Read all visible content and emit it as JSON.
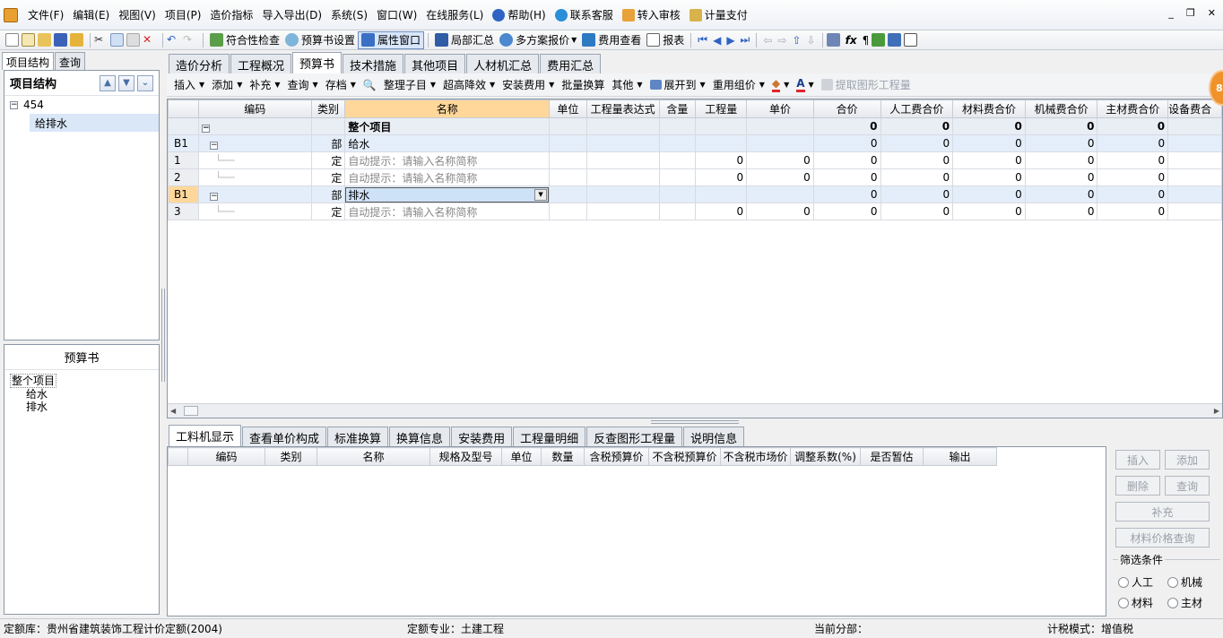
{
  "menubar": {
    "items": [
      "文件(F)",
      "编辑(E)",
      "视图(V)",
      "项目(P)",
      "造价指标",
      "导入导出(D)",
      "系统(S)",
      "窗口(W)",
      "在线服务(L)",
      "帮助(H)",
      "联系客服",
      "转入审核",
      "计量支付"
    ]
  },
  "toolbar": {
    "items": [
      "符合性检查",
      "预算书设置",
      "属性窗口",
      "局部汇总",
      "多方案报价",
      "费用查看",
      "报表"
    ]
  },
  "left": {
    "tabs": [
      "项目结构",
      "查询"
    ],
    "tree_title": "项目结构",
    "tree": [
      "454",
      "给排水"
    ],
    "budget_title": "预算书",
    "budget_tree": [
      "整个项目",
      "给水",
      "排水"
    ]
  },
  "main": {
    "tabs": [
      "造价分析",
      "工程概况",
      "预算书",
      "技术措施",
      "其他项目",
      "人材机汇总",
      "费用汇总"
    ],
    "subtoolbar": [
      "插入",
      "添加",
      "补充",
      "查询",
      "存档",
      "整理子目",
      "超高降效",
      "安装费用",
      "批量换算",
      "其他",
      "展开到",
      "重用组价",
      "提取图形工程量"
    ],
    "columns": [
      "编码",
      "类别",
      "名称",
      "单位",
      "工程量表达式",
      "含量",
      "工程量",
      "单价",
      "合价",
      "人工费合价",
      "材料费合价",
      "机械费合价",
      "主材费合价",
      "设备费合"
    ],
    "rows": [
      {
        "rh": "",
        "code": "",
        "type": "",
        "name": "整个项目",
        "qty": "",
        "price": "",
        "total": "0",
        "rg": "0",
        "cl": "0",
        "jx": "0",
        "zc": "0"
      },
      {
        "rh": "B1",
        "code": "",
        "type": "部",
        "name": "给水",
        "qty": "",
        "price": "",
        "total": "0",
        "rg": "0",
        "cl": "0",
        "jx": "0",
        "zc": "0"
      },
      {
        "rh": "1",
        "code": "",
        "type": "定",
        "name": "自动提示：请输入名称简称",
        "qty": "0",
        "price": "0",
        "total": "0",
        "rg": "0",
        "cl": "0",
        "jx": "0",
        "zc": "0"
      },
      {
        "rh": "2",
        "code": "",
        "type": "定",
        "name": "自动提示：请输入名称简称",
        "qty": "0",
        "price": "0",
        "total": "0",
        "rg": "0",
        "cl": "0",
        "jx": "0",
        "zc": "0"
      },
      {
        "rh": "B1",
        "code": "",
        "type": "部",
        "name": "排水",
        "qty": "",
        "price": "",
        "total": "0",
        "rg": "0",
        "cl": "0",
        "jx": "0",
        "zc": "0"
      },
      {
        "rh": "3",
        "code": "",
        "type": "定",
        "name": "自动提示：请输入名称简称",
        "qty": "0",
        "price": "0",
        "total": "0",
        "rg": "0",
        "cl": "0",
        "jx": "0",
        "zc": "0"
      }
    ]
  },
  "bottom": {
    "tabs": [
      "工料机显示",
      "查看单价构成",
      "标准换算",
      "换算信息",
      "安装费用",
      "工程量明细",
      "反查图形工程量",
      "说明信息"
    ],
    "columns": [
      "编码",
      "类别",
      "名称",
      "规格及型号",
      "单位",
      "数量",
      "含税预算价",
      "不含税预算价",
      "不含税市场价",
      "调整系数(%)",
      "是否暂估",
      "输出"
    ],
    "buttons": [
      "插入",
      "添加",
      "删除",
      "查询",
      "补充",
      "材料价格查询"
    ],
    "filter_title": "筛选条件",
    "filters": [
      "人工",
      "机械",
      "材料",
      "主材"
    ]
  },
  "status": {
    "quota_lib": "定额库：贵州省建筑装饰工程计价定额(2004)",
    "quota_major": "定额专业：土建工程",
    "current_part": "当前分部：",
    "tax_mode": "计税模式：增值税"
  },
  "badge": "8"
}
